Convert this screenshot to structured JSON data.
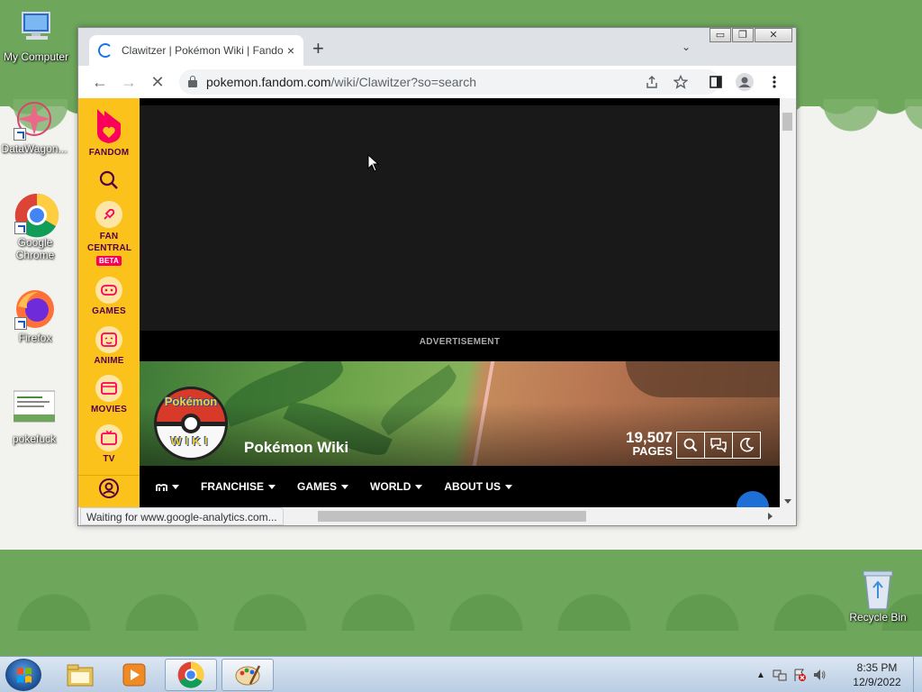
{
  "desktop": {
    "icons": [
      {
        "label": "My Computer",
        "icon": "computer-icon"
      },
      {
        "label": "DataWagon...",
        "icon": "datawagon-icon"
      },
      {
        "label": "Google Chrome",
        "icon": "chrome-icon"
      },
      {
        "label": "Firefox",
        "icon": "firefox-icon"
      },
      {
        "label": "pokefuck",
        "icon": "document-thumbnail-icon"
      },
      {
        "label": "Recycle Bin",
        "icon": "recycle-bin-icon"
      }
    ]
  },
  "browser": {
    "tab": {
      "title": "Clawitzer | Pokémon Wiki | Fandom",
      "close": "×"
    },
    "new_tab": "+",
    "tab_list": "⌄",
    "window_controls": {
      "minimize": "▭",
      "restore": "❐",
      "close": "✕"
    },
    "toolbar": {
      "back": "←",
      "forward": "→",
      "stop": "✕"
    },
    "url": {
      "host": "pokemon.fandom.com",
      "path": "/wiki/Clawitzer?so=search"
    },
    "status": "Waiting for www.google-analytics.com..."
  },
  "fandom": {
    "sidebar": [
      {
        "label": "FANDOM",
        "icon": "fandom-logo-icon"
      },
      {
        "label": "",
        "icon": "search-icon"
      },
      {
        "label": "FAN CENTRAL",
        "icon": "rocket-icon",
        "badge": "BETA"
      },
      {
        "label": "GAMES",
        "icon": "gamepad-icon"
      },
      {
        "label": "ANIME",
        "icon": "anime-icon"
      },
      {
        "label": "MOVIES",
        "icon": "movies-icon"
      },
      {
        "label": "TV",
        "icon": "tv-icon"
      },
      {
        "label": "",
        "icon": "account-icon"
      }
    ],
    "ad_label": "ADVERTISEMENT",
    "wiki": {
      "logo_top": "Pokémon",
      "logo_bottom": "WIKI",
      "name": "Pokémon Wiki",
      "pages_count": "19,507",
      "pages_label": "PAGES"
    },
    "nav": [
      {
        "label": "FRANCHISE"
      },
      {
        "label": "GAMES"
      },
      {
        "label": "WORLD"
      },
      {
        "label": "ABOUT US"
      }
    ]
  },
  "taskbar": {
    "apps": [
      "windows-explorer-icon",
      "media-player-icon",
      "chrome-icon",
      "paint-icon"
    ],
    "clock_time": "8:35 PM",
    "clock_date": "12/9/2022"
  }
}
